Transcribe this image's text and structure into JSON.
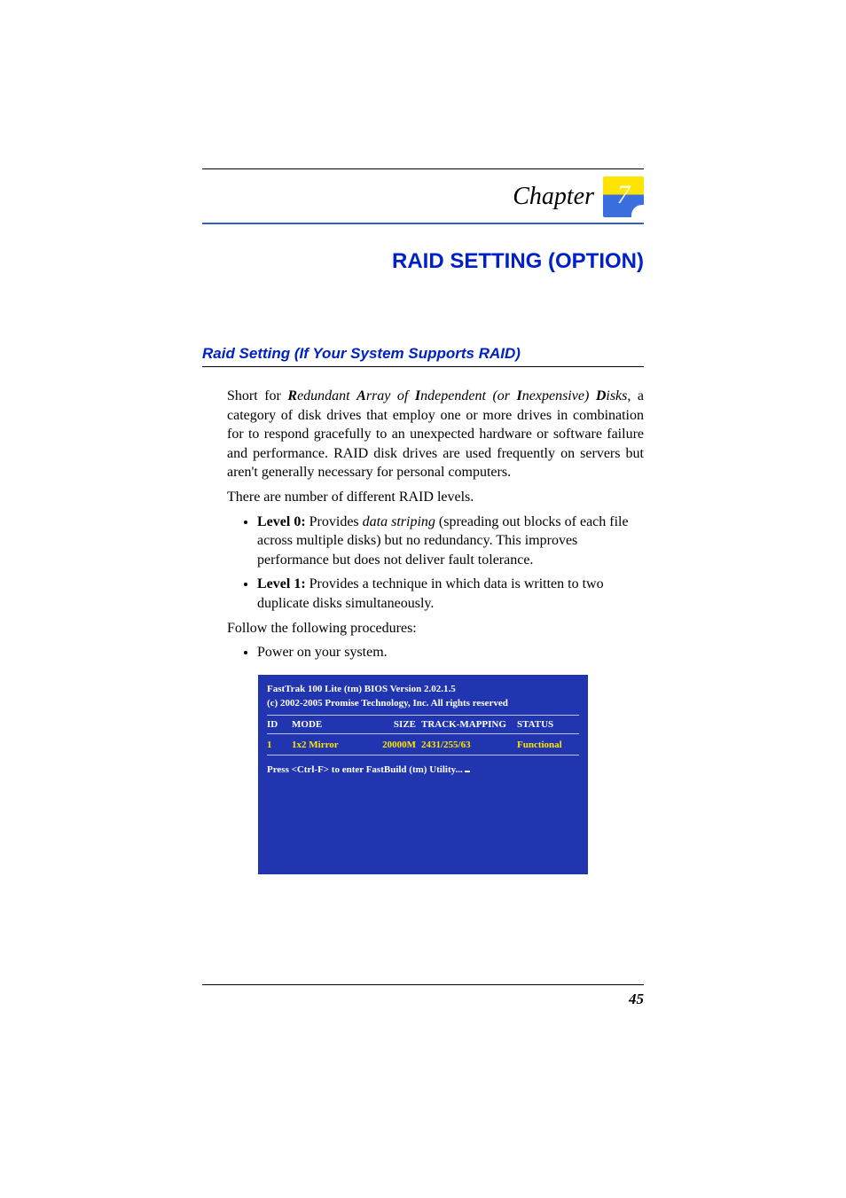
{
  "chapter": {
    "label": "Chapter",
    "number": "7"
  },
  "title": "RAID SETTING (OPTION)",
  "section_heading": "Raid Setting (If Your System Supports RAID)",
  "intro": {
    "pre": "Short for ",
    "r": "R",
    "r_rest": "edundant ",
    "a": "A",
    "a_rest": "rray of ",
    "i": "I",
    "i_rest": "ndependent (or ",
    "i2": "I",
    "i2_rest": "nexpensive) ",
    "d": "D",
    "d_rest": "isks,",
    "tail": " a category of disk drives that employ one or more drives in combination for to respond gracefully to an unexpected hardware or software failure and performance. RAID disk drives are used frequently on servers but aren't generally necessary for personal computers."
  },
  "levels_intro": "There are number of different RAID levels.",
  "level0": {
    "label": "Level 0:",
    "pre": " Provides ",
    "em": "data striping",
    "post": " (spreading out blocks of each file across multiple disks) but no redundancy. This improves performance but does not deliver fault tolerance."
  },
  "level1": {
    "label": "Level 1:",
    "text": " Provides a technique in which data is written to two duplicate disks simultaneously."
  },
  "follow": "Follow the following procedures:",
  "step1": "Power on your system.",
  "bios": {
    "line1": "FastTrak 100  Lite  (tm) BIOS Version 2.02.1.5",
    "line2": "(c) 2002-2005 Promise Technology, Inc.  All rights reserved",
    "headers": {
      "id": "ID",
      "mode": "MODE",
      "size": "SIZE",
      "track": "TRACK-MAPPING",
      "status": "STATUS"
    },
    "row": {
      "id": "1",
      "mode": "1x2 Mirror",
      "size": "20000M",
      "track": "2431/255/63",
      "status": "Functional"
    },
    "prompt": "Press <Ctrl-F> to enter FastBuild (tm) Utility..."
  },
  "page_number": "45"
}
